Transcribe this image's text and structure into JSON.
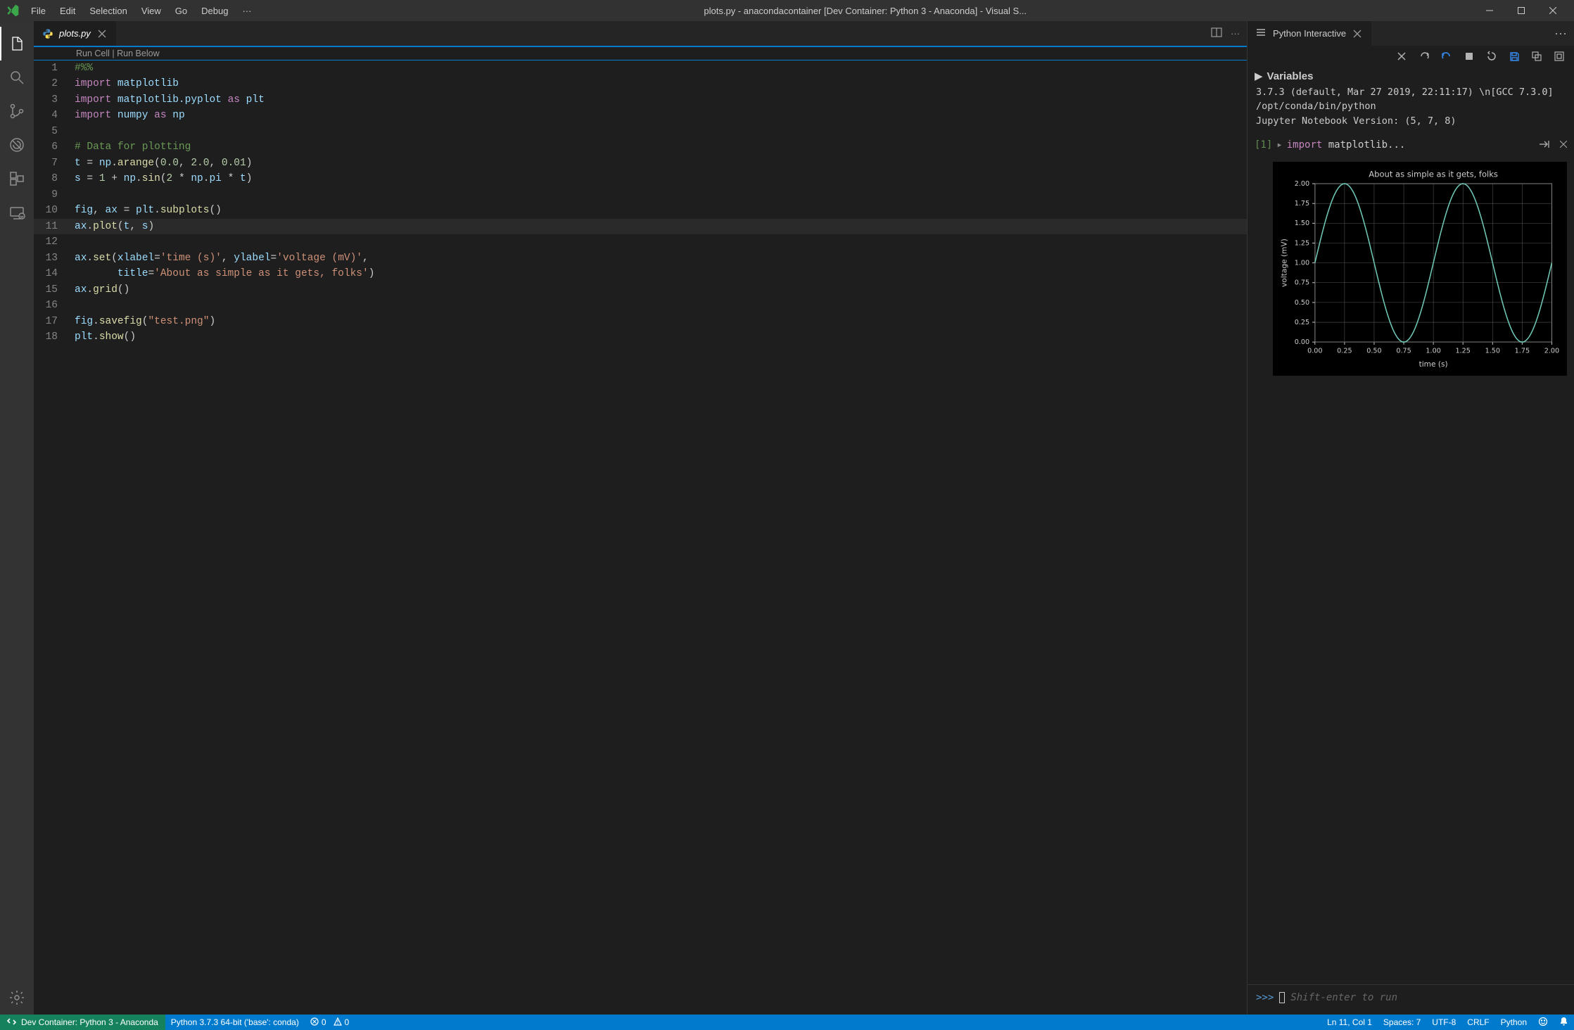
{
  "menu": {
    "file": "File",
    "edit": "Edit",
    "selection": "Selection",
    "view": "View",
    "go": "Go",
    "debug": "Debug"
  },
  "window_title": "plots.py - anacondacontainer [Dev Container: Python 3 - Anaconda] - Visual S...",
  "editor_tab": {
    "name": "plots.py"
  },
  "codelens": {
    "run_cell": "Run Cell",
    "sep": " | ",
    "run_below": "Run Below"
  },
  "code_lines": [
    {
      "n": "1",
      "tokens": [
        [
          "cm",
          "#%%"
        ]
      ]
    },
    {
      "n": "2",
      "tokens": [
        [
          "kw",
          "import"
        ],
        [
          "",
          " "
        ],
        [
          "var",
          "matplotlib"
        ]
      ]
    },
    {
      "n": "3",
      "tokens": [
        [
          "kw",
          "import"
        ],
        [
          "",
          " "
        ],
        [
          "var",
          "matplotlib.pyplot"
        ],
        [
          "",
          " "
        ],
        [
          "kw",
          "as"
        ],
        [
          "",
          " "
        ],
        [
          "var",
          "plt"
        ]
      ]
    },
    {
      "n": "4",
      "tokens": [
        [
          "kw",
          "import"
        ],
        [
          "",
          " "
        ],
        [
          "var",
          "numpy"
        ],
        [
          "",
          " "
        ],
        [
          "kw",
          "as"
        ],
        [
          "",
          " "
        ],
        [
          "var",
          "np"
        ]
      ]
    },
    {
      "n": "5",
      "tokens": []
    },
    {
      "n": "6",
      "tokens": [
        [
          "cm",
          "# Data for plotting"
        ]
      ]
    },
    {
      "n": "7",
      "tokens": [
        [
          "var",
          "t"
        ],
        [
          "",
          " = "
        ],
        [
          "var",
          "np"
        ],
        [
          "",
          "."
        ],
        [
          "fn",
          "arange"
        ],
        [
          "",
          "("
        ],
        [
          "num",
          "0.0"
        ],
        [
          "",
          ", "
        ],
        [
          "num",
          "2.0"
        ],
        [
          "",
          ", "
        ],
        [
          "num",
          "0.01"
        ],
        [
          "",
          ")"
        ]
      ]
    },
    {
      "n": "8",
      "tokens": [
        [
          "var",
          "s"
        ],
        [
          "",
          " = "
        ],
        [
          "num",
          "1"
        ],
        [
          "",
          " + "
        ],
        [
          "var",
          "np"
        ],
        [
          "",
          "."
        ],
        [
          "fn",
          "sin"
        ],
        [
          "",
          "("
        ],
        [
          "num",
          "2"
        ],
        [
          "",
          " * "
        ],
        [
          "var",
          "np"
        ],
        [
          "",
          "."
        ],
        [
          "var",
          "pi"
        ],
        [
          "",
          " * "
        ],
        [
          "var",
          "t"
        ],
        [
          "",
          ")"
        ]
      ]
    },
    {
      "n": "9",
      "tokens": []
    },
    {
      "n": "10",
      "tokens": [
        [
          "var",
          "fig"
        ],
        [
          "",
          ", "
        ],
        [
          "var",
          "ax"
        ],
        [
          "",
          " = "
        ],
        [
          "var",
          "plt"
        ],
        [
          "",
          "."
        ],
        [
          "fn",
          "subplots"
        ],
        [
          "",
          "()"
        ]
      ]
    },
    {
      "n": "11",
      "current": true,
      "tokens": [
        [
          "var",
          "ax"
        ],
        [
          "",
          "."
        ],
        [
          "fn",
          "plot"
        ],
        [
          "",
          "("
        ],
        [
          "var",
          "t"
        ],
        [
          "",
          ", "
        ],
        [
          "var",
          "s"
        ],
        [
          "",
          ")"
        ]
      ]
    },
    {
      "n": "12",
      "tokens": []
    },
    {
      "n": "13",
      "tokens": [
        [
          "var",
          "ax"
        ],
        [
          "",
          "."
        ],
        [
          "fn",
          "set"
        ],
        [
          "",
          "("
        ],
        [
          "var",
          "xlabel"
        ],
        [
          "",
          "="
        ],
        [
          "str",
          "'time (s)'"
        ],
        [
          "",
          ", "
        ],
        [
          "var",
          "ylabel"
        ],
        [
          "",
          "="
        ],
        [
          "str",
          "'voltage (mV)'"
        ],
        [
          "",
          ","
        ]
      ]
    },
    {
      "n": "14",
      "tokens": [
        [
          "",
          "       "
        ],
        [
          "var",
          "title"
        ],
        [
          "",
          "="
        ],
        [
          "str",
          "'About as simple as it gets, folks'"
        ],
        [
          "",
          ")"
        ]
      ]
    },
    {
      "n": "15",
      "tokens": [
        [
          "var",
          "ax"
        ],
        [
          "",
          "."
        ],
        [
          "fn",
          "grid"
        ],
        [
          "",
          "()"
        ]
      ]
    },
    {
      "n": "16",
      "tokens": []
    },
    {
      "n": "17",
      "tokens": [
        [
          "var",
          "fig"
        ],
        [
          "",
          "."
        ],
        [
          "fn",
          "savefig"
        ],
        [
          "",
          "("
        ],
        [
          "str",
          "\"test.png\""
        ],
        [
          "",
          ")"
        ]
      ]
    },
    {
      "n": "18",
      "tokens": [
        [
          "var",
          "plt"
        ],
        [
          "",
          "."
        ],
        [
          "fn",
          "show"
        ],
        [
          "",
          "()"
        ]
      ]
    }
  ],
  "interactive": {
    "tab_title": "Python Interactive",
    "variables_label": "Variables",
    "info_line1": "3.7.3 (default, Mar 27 2019, 22:11:17) \\n[GCC 7.3.0]",
    "info_line2": "/opt/conda/bin/python",
    "info_line3": "Jupyter Notebook Version: (5, 7, 8)",
    "cell_idx": "[1]",
    "cell_code_kw": "import",
    "cell_code_rest": " matplotlib...",
    "repl_prompt": ">>>",
    "repl_placeholder": "Shift-enter to run"
  },
  "status": {
    "remote": "Dev Container: Python 3 - Anaconda",
    "python": "Python 3.7.3 64-bit ('base': conda)",
    "errors": "0",
    "warnings": "0",
    "ln_col": "Ln 11, Col 1",
    "spaces": "Spaces: 7",
    "encoding": "UTF-8",
    "eol": "CRLF",
    "lang": "Python"
  },
  "chart_data": {
    "type": "line",
    "title": "About as simple as it gets, folks",
    "xlabel": "time (s)",
    "ylabel": "voltage (mV)",
    "xlim": [
      0.0,
      2.0
    ],
    "ylim": [
      0.0,
      2.0
    ],
    "xticks": [
      0.0,
      0.25,
      0.5,
      0.75,
      1.0,
      1.25,
      1.5,
      1.75,
      2.0
    ],
    "yticks": [
      0.0,
      0.25,
      0.5,
      0.75,
      1.0,
      1.25,
      1.5,
      1.75,
      2.0
    ],
    "grid": true,
    "line_color": "#6fc7b7",
    "series": [
      {
        "name": "s",
        "formula": "1 + sin(2*pi*t)",
        "t_start": 0.0,
        "t_end": 2.0,
        "t_step": 0.01
      }
    ]
  }
}
